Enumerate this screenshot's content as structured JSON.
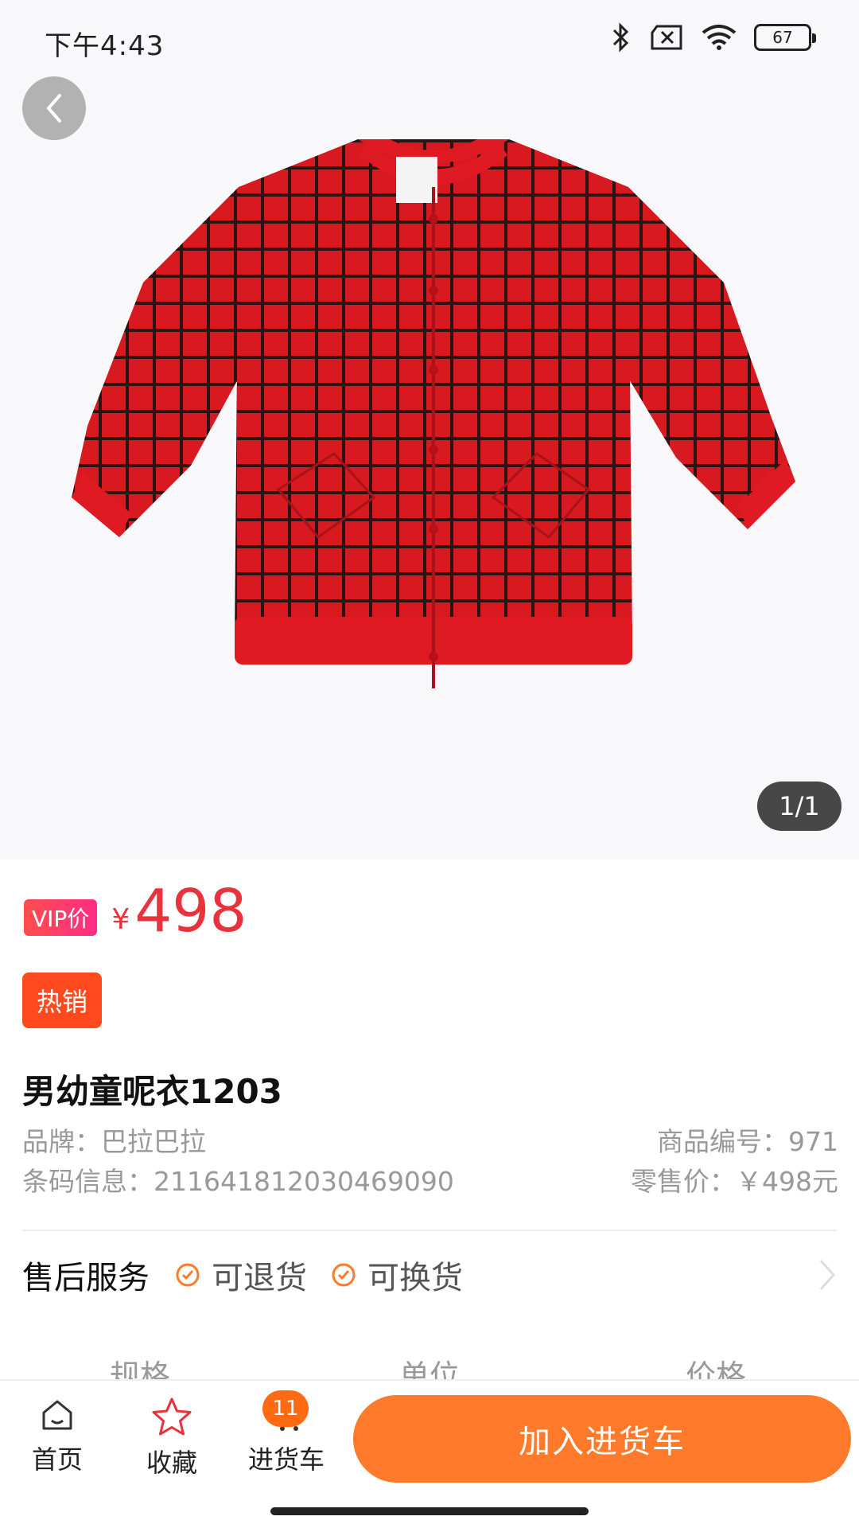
{
  "status_bar": {
    "time": "下午4:43",
    "battery": "67"
  },
  "gallery": {
    "counter": "1/1"
  },
  "price": {
    "vip_label": "VIP价",
    "currency": "¥",
    "value": "498"
  },
  "tag": {
    "hot": "热销"
  },
  "product": {
    "title": "男幼童呢衣1203",
    "brand": "品牌：巴拉巴拉",
    "barcode": "条码信息：211641812030469090",
    "item_no": "商品编号：971",
    "retail_price": "零售价：￥498元"
  },
  "service": {
    "title": "售后服务",
    "items": [
      "可退货",
      "可换货"
    ]
  },
  "spec_table": {
    "columns": [
      "规格",
      "单位",
      "价格"
    ]
  },
  "bottom_nav": {
    "home": "首页",
    "favorite": "收藏",
    "cart": "进货车",
    "cart_count": "11",
    "add_button": "加入进货车"
  },
  "colors": {
    "accent": "#ff7a2b",
    "price": "#e8323c",
    "hot": "#ff4a1f"
  }
}
